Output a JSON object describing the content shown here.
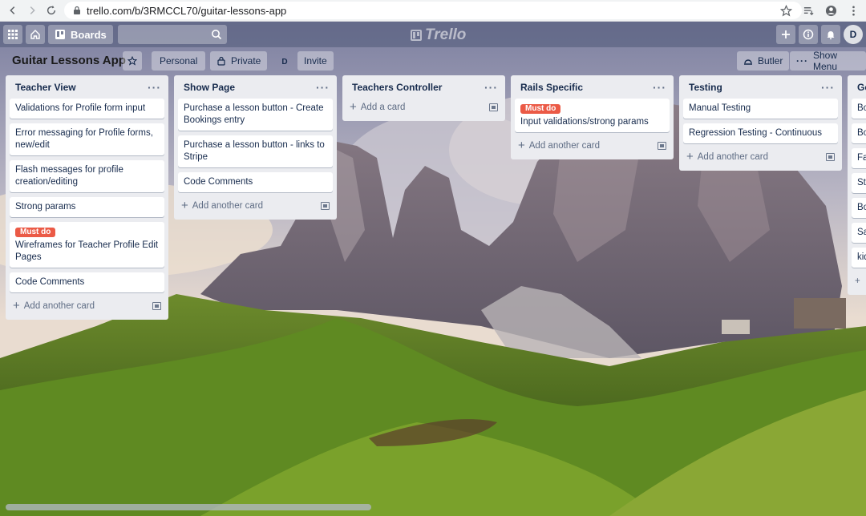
{
  "browser": {
    "url": "trello.com/b/3RMCCL70/guitar-lessons-app",
    "profile_initial": "D"
  },
  "header": {
    "boards_label": "Boards",
    "logo_text": "Trello",
    "avatar_initial": "D"
  },
  "board": {
    "title": "Guitar Lessons App",
    "personal_label": "Personal",
    "private_label": "Private",
    "member_initial": "D",
    "invite_label": "Invite",
    "butler_label": "Butler",
    "show_menu_label": "Show Menu"
  },
  "lists": [
    {
      "name": "Teacher View",
      "menu": "···",
      "cards": [
        {
          "text": "Validations for Profile form input"
        },
        {
          "text": "Error messaging for Profile forms, new/edit"
        },
        {
          "text": "Flash messages for profile creation/editing"
        },
        {
          "text": "Strong params"
        },
        {
          "label": "Must do",
          "text": "Wireframes for Teacher Profile Edit Pages"
        },
        {
          "text": "Code Comments"
        }
      ],
      "add_label": "Add another card"
    },
    {
      "name": "Show Page",
      "menu": "···",
      "cards": [
        {
          "text": "Purchase a lesson button - Create Bookings entry"
        },
        {
          "text": "Purchase a lesson button - links to Stripe"
        },
        {
          "text": "Code Comments"
        }
      ],
      "add_label": "Add another card"
    },
    {
      "name": "Teachers Controller",
      "menu": "···",
      "cards": [],
      "add_label": "Add a card"
    },
    {
      "name": "Rails Specific",
      "menu": "···",
      "cards": [
        {
          "label": "Must do",
          "text": "Input validations/strong params"
        }
      ],
      "add_label": "Add another card"
    },
    {
      "name": "Testing",
      "menu": "···",
      "cards": [
        {
          "text": "Manual Testing"
        },
        {
          "text": "Regression Testing - Continuous"
        }
      ],
      "add_label": "Add another card"
    },
    {
      "name": "Ge",
      "menu": "",
      "cards": [
        {
          "text": "Bo bo"
        },
        {
          "text": "Bo rel"
        },
        {
          "text": "Fa"
        },
        {
          "text": "Str"
        },
        {
          "text": "Bo"
        },
        {
          "text": "Sa"
        },
        {
          "text": "kid - f"
        }
      ],
      "add_label": "+"
    }
  ],
  "colors": {
    "label_red": "#eb5a46",
    "list_bg": "#ebecf0"
  }
}
